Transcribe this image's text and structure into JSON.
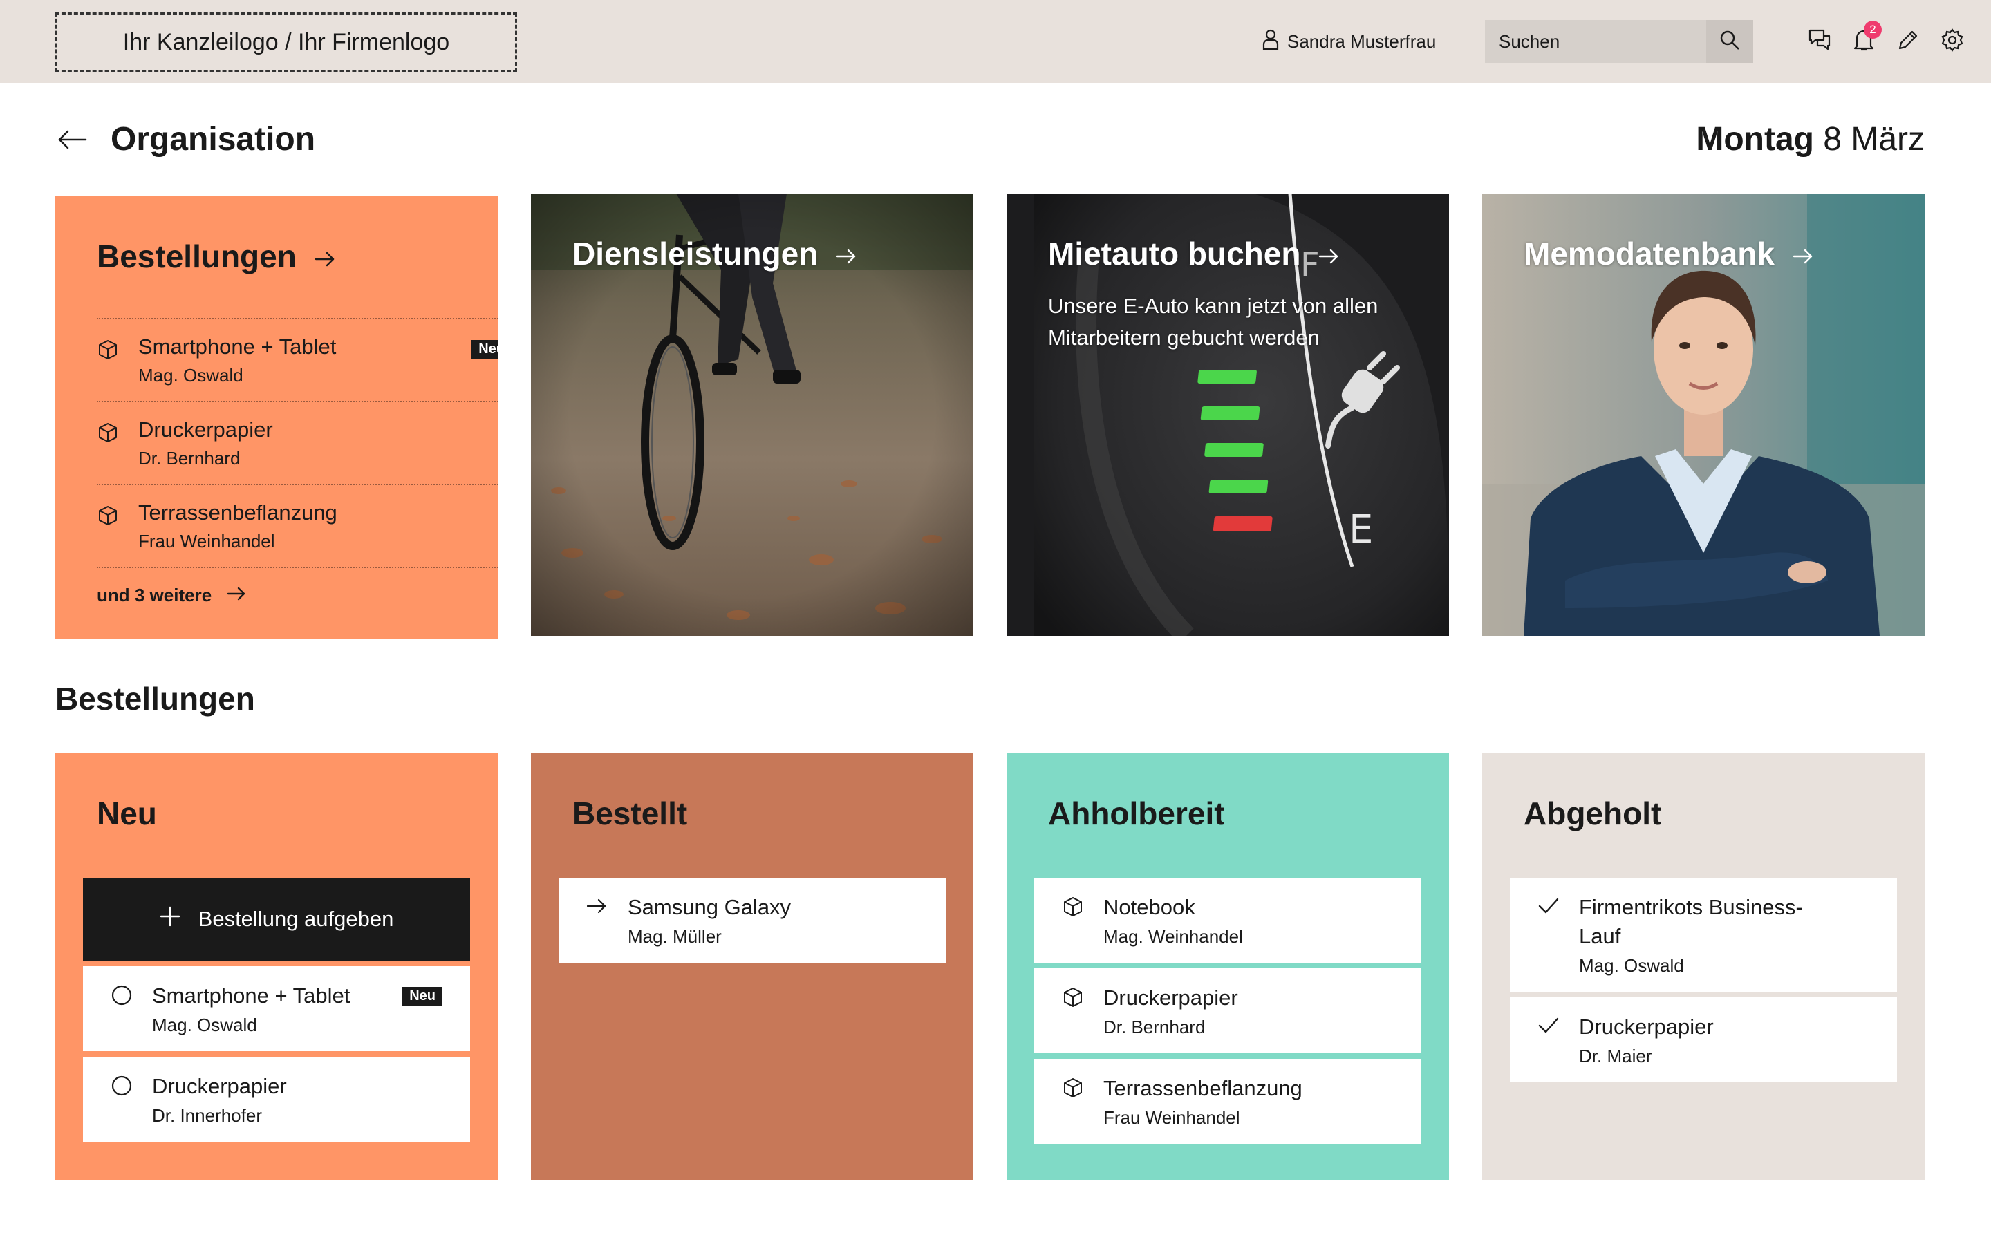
{
  "header": {
    "logo_text": "Ihr Kanzleilogo / Ihr Firmenlogo",
    "user_name": "Sandra Musterfrau",
    "search_placeholder": "Suchen",
    "notification_count": "2",
    "icons": [
      "user-icon",
      "search-icon",
      "chat-icon",
      "bell-icon",
      "pencil-icon",
      "gear-icon"
    ]
  },
  "page": {
    "title": "Organisation",
    "date_day": "Montag",
    "date_rest": "8 März"
  },
  "cards": {
    "orders": {
      "title": "Bestellungen",
      "items": [
        {
          "title": "Smartphone + Tablet",
          "sub": "Mag. Oswald",
          "badge": "Neu"
        },
        {
          "title": "Druckerpapier",
          "sub": "Dr. Bernhard"
        },
        {
          "title": "Terrassenbeflanzung",
          "sub": "Frau Weinhandel"
        }
      ],
      "more": "und 3 weitere"
    },
    "services": {
      "title": "Diensleistungen"
    },
    "car": {
      "title": "Mietauto buchen",
      "subtitle": "Unsere E-Auto kann jetzt von allen Mitarbeitern gebucht werden"
    },
    "memo": {
      "title": "Memodatenbank"
    }
  },
  "section": {
    "title": "Bestellungen"
  },
  "kanban": {
    "new": {
      "title": "Neu",
      "add_button": "Bestellung aufgeben",
      "items": [
        {
          "title": "Smartphone + Tablet",
          "sub": "Mag. Oswald",
          "badge": "Neu"
        },
        {
          "title": "Druckerpapier",
          "sub": "Dr. Innerhofer"
        }
      ]
    },
    "ordered": {
      "title": "Bestellt",
      "items": [
        {
          "title": "Samsung Galaxy",
          "sub": "Mag. Müller"
        }
      ]
    },
    "ready": {
      "title": "Ahholbereit",
      "items": [
        {
          "title": "Notebook",
          "sub": "Mag. Weinhandel"
        },
        {
          "title": "Druckerpapier",
          "sub": "Dr. Bernhard"
        },
        {
          "title": "Terrassenbeflanzung",
          "sub": "Frau Weinhandel"
        }
      ]
    },
    "picked": {
      "title": "Abgeholt",
      "items": [
        {
          "title": "Firmentrikots Business-Lauf",
          "sub": "Mag. Oswald"
        },
        {
          "title": "Druckerpapier",
          "sub": "Dr. Maier"
        }
      ]
    }
  },
  "colors": {
    "orange": "#ff9566",
    "terracotta": "#c77858",
    "mint": "#80dac6",
    "beige": "#e8e1dc",
    "dark": "#1a1a1a",
    "badge_red": "#ef3b6e"
  }
}
